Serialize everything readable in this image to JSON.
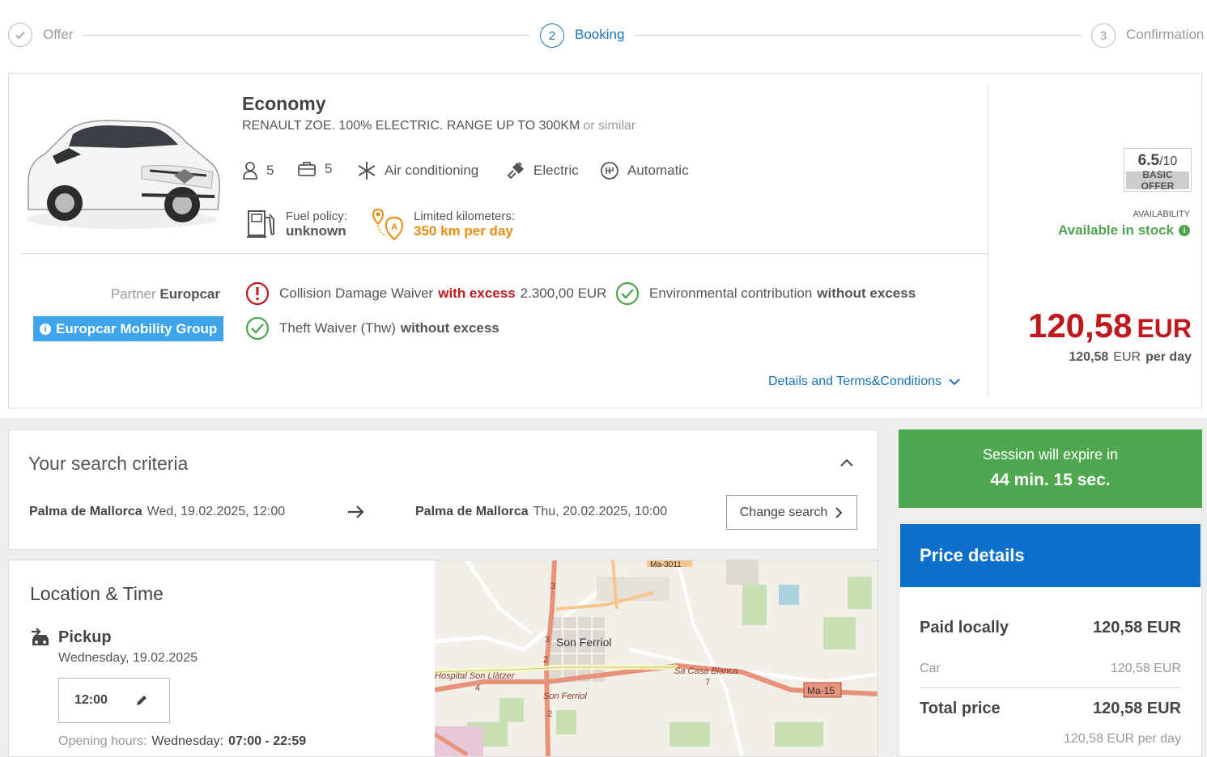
{
  "steps": [
    {
      "number": "✓",
      "label": "Offer",
      "state": "done"
    },
    {
      "number": "2",
      "label": "Booking",
      "state": "active"
    },
    {
      "number": "3",
      "label": "Confirmation",
      "state": "pending"
    }
  ],
  "offer": {
    "car_class": "Economy",
    "car_model": "RENAULT ZOE. 100% ELECTRIC. RANGE UP TO 300KM",
    "or_similar": "or similar",
    "seats": "5",
    "bags": "5",
    "air_conditioning": "Air conditioning",
    "fuel_type": "Electric",
    "transmission": "Automatic",
    "fuel_policy_label": "Fuel policy:",
    "fuel_policy_value": "unknown",
    "km_label": "Limited kilometers:",
    "km_value": "350 km per day",
    "partner_label": "Partner",
    "partner_name": "Europcar",
    "mobility_badge": "Europcar Mobility Group",
    "cdw_label": "Collision Damage Waiver",
    "cdw_excess": "with excess",
    "cdw_amount": "2.300,00 EUR",
    "env_label": "Environmental contribution",
    "env_excess": "without excess",
    "theft_label": "Theft Waiver (Thw)",
    "theft_excess": "without excess",
    "details_link": "Details and Terms&Conditions",
    "rating_score": "6.5",
    "rating_max": "/10",
    "rating_label": "BASIC OFFER",
    "availability_label": "AVAILABILITY",
    "availability_value": "Available in stock",
    "price": "120,58",
    "currency": "EUR",
    "price_per_day_value": "120,58",
    "price_per_day_currency": "EUR",
    "price_per_day_suffix": "per day"
  },
  "search": {
    "title": "Your search criteria",
    "pickup_location": "Palma de Mallorca",
    "pickup_datetime": "Wed, 19.02.2025, 12:00",
    "return_location": "Palma de Mallorca",
    "return_datetime": "Thu, 20.02.2025, 10:00",
    "change_button": "Change search"
  },
  "location": {
    "title": "Location & Time",
    "pickup_title": "Pickup",
    "pickup_date": "Wednesday, 19.02.2025",
    "pickup_time": "12:00",
    "opening_label": "Opening hours:",
    "opening_day": "Wednesday:",
    "opening_hours": "07:00 - 22:59"
  },
  "map": {
    "labels": [
      "Son Ferriol",
      "Hospital Son Llàtzer",
      "Sa Casa Blanca",
      "Son Ferriol",
      "Ma-15",
      "Ma-3011",
      "3",
      "3",
      "2",
      "2",
      "4",
      "7"
    ]
  },
  "session": {
    "line1": "Session will expire in",
    "line2": "44 min. 15 sec."
  },
  "price_details": {
    "title": "Price details",
    "paid_locally_label": "Paid locally",
    "paid_locally_value": "120,58 EUR",
    "car_label": "Car",
    "car_value": "120,58 EUR",
    "total_label": "Total price",
    "total_value": "120,58 EUR",
    "per_day": "120,58 EUR per day"
  },
  "colors": {
    "primary_blue": "#1a73b8",
    "price_red": "#c0191d",
    "success_green": "#4fa74f",
    "warning_orange": "#e98b10",
    "header_blue": "#0d6fc9"
  }
}
